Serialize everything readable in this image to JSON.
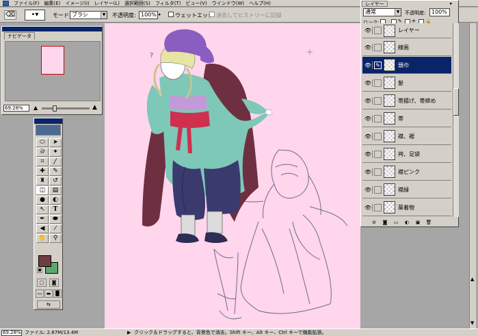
{
  "menu": {
    "items": [
      "ファイル(F)",
      "編集(E)",
      "イメージ(I)",
      "レイヤー(L)",
      "選択範囲(S)",
      "フィルタ(T)",
      "ビュー(V)",
      "ウインドウ(W)",
      "ヘルプ(H)"
    ]
  },
  "options": {
    "mode_label": "モード:",
    "mode_value": "ブラシ",
    "opacity_label": "不透明度:",
    "opacity_value": "100%",
    "wet_edges_label": "ウェットエッジ",
    "history_label": "消去してヒストリーに記録"
  },
  "navigator": {
    "tab_label": "ナビゲータ",
    "zoom": "69.28%"
  },
  "layers": {
    "tab_label": "レイヤー",
    "blend_mode": "通常",
    "opacity_label": "不透明度:",
    "opacity_value": "100%",
    "lock_label": "ロック:",
    "items": [
      {
        "name": "線画"
      },
      {
        "name": "頭巾"
      },
      {
        "name": "髪"
      },
      {
        "name": "帯揚げ、帯締め"
      },
      {
        "name": "帯"
      },
      {
        "name": "襟、裾"
      },
      {
        "name": "袴、足袋"
      },
      {
        "name": "襟ピンク"
      },
      {
        "name": "襟緑"
      },
      {
        "name": "薬着物"
      }
    ]
  },
  "tools": {
    "icons": [
      "marquee-icon",
      "move-icon",
      "lasso-icon",
      "magic-wand-icon",
      "crop-icon",
      "slice-icon",
      "healing-icon",
      "brush-icon",
      "stamp-icon",
      "history-brush-icon",
      "eraser-icon",
      "gradient-icon",
      "blur-icon",
      "dodge-icon",
      "path-select-icon",
      "type-icon",
      "pen-icon",
      "shape-icon",
      "notes-icon",
      "eyedropper-icon",
      "hand-icon",
      "zoom-icon"
    ],
    "foreground_color": "#6e3e44",
    "background_color": "#5aa86e"
  },
  "status": {
    "zoom": "69.28%",
    "file_info": "ファイル: 2.87M/13.4M",
    "hint": "クリック＆ドラッグすると、背景色で消去。Shift キー、Alt キー、Ctrl キーで機能拡張。"
  },
  "canvas": {
    "background": "#ffd6ec"
  }
}
